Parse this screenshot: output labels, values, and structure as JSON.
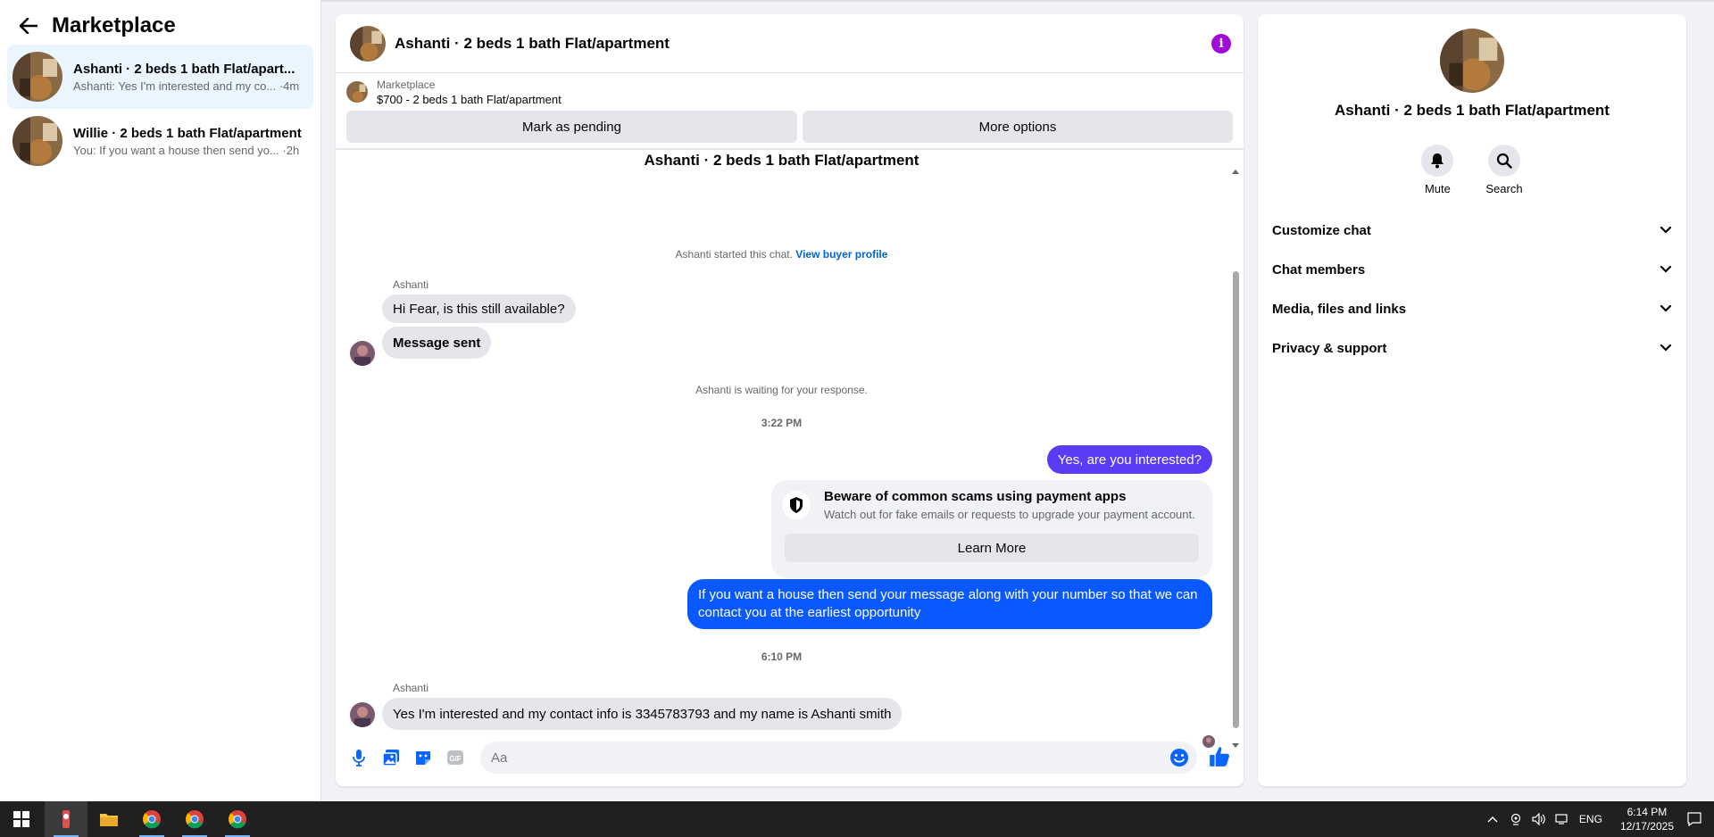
{
  "sidebar": {
    "title": "Marketplace",
    "conversations": [
      {
        "name": "Ashanti · 2 beds 1 bath Flat/apart...",
        "preview": "Ashanti: Yes I'm interested and my co... ·4m"
      },
      {
        "name": "Willie · 2 beds 1 bath Flat/apartment",
        "preview": "You: If you want a house then send yo... ·2h"
      }
    ]
  },
  "chat": {
    "header_title": "Ashanti · 2 beds 1 bath Flat/apartment",
    "listing_category": "Marketplace",
    "listing_title": "$700 - 2 beds 1 bath Flat/apartment",
    "mark_pending_label": "Mark as pending",
    "more_options_label": "More options",
    "thread_title": "Ashanti · 2 beds 1 bath Flat/apartment",
    "started_text": "Ashanti started this chat.",
    "view_buyer_profile": "View buyer profile",
    "sender1": "Ashanti",
    "msg1": "Hi Fear, is this still available?",
    "msg2": "Message sent",
    "waiting_text": "Ashanti is waiting for your response.",
    "time1": "3:22 PM",
    "out1": "Yes, are you interested?",
    "scam_title": "Beware of common scams using payment apps",
    "scam_sub": "Watch out for fake emails or requests to upgrade your payment account.",
    "scam_button": "Learn More",
    "out2": "If you want a house then send your message along with your number so that we can contact you at the earliest opportunity",
    "time2": "6:10 PM",
    "sender2": "Ashanti",
    "msg3": "Yes I'm interested and my contact info is 3345783793 and my name is Ashanti smith",
    "composer_placeholder": "Aa"
  },
  "info_panel": {
    "name": "Ashanti · 2 beds 1 bath Flat/apartment",
    "mute_label": "Mute",
    "search_label": "Search",
    "sections": [
      "Customize chat",
      "Chat members",
      "Media, files and links",
      "Privacy & support"
    ]
  },
  "taskbar": {
    "language": "ENG",
    "time": "6:14 PM",
    "date": "12/17/2025"
  },
  "colors": {
    "accent_blue": "#0a58ff",
    "purple_bubble": "#5b3bf5",
    "info_icon": "#a20ad6",
    "link": "#0064d1"
  }
}
